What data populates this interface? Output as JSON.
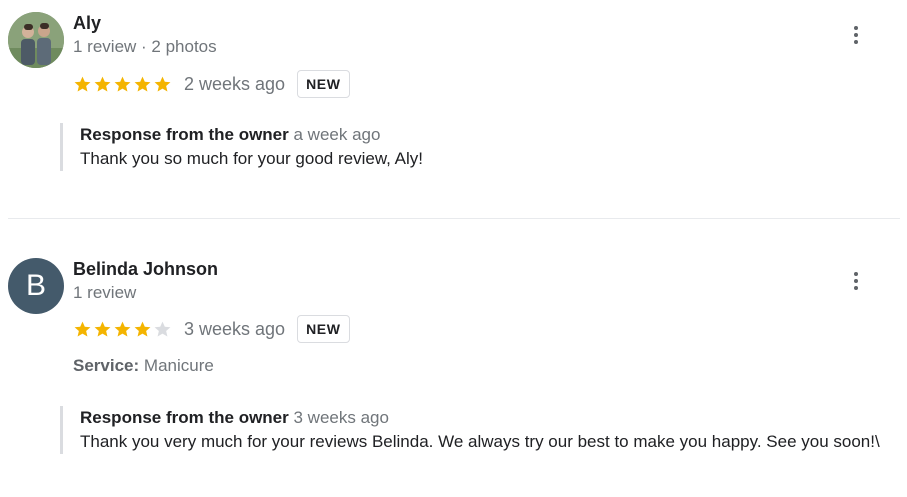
{
  "colors": {
    "star_filled": "#f4b400",
    "star_empty": "#dadce0",
    "avatar_bg": "#445a6b"
  },
  "reviews": [
    {
      "avatar_icon": "user-photo-avatar",
      "name": "Aly",
      "meta": "1 review · 2 photos",
      "rating": 5,
      "date": "2 weeks ago",
      "badge": "NEW",
      "response": {
        "title": "Response from the owner",
        "date": "a week ago",
        "text": "Thank you so much for your good review, Aly!"
      }
    },
    {
      "avatar_letter": "B",
      "name": "Belinda Johnson",
      "meta": "1 review",
      "rating": 4,
      "date": "3 weeks ago",
      "badge": "NEW",
      "service_label": "Service:",
      "service_value": "Manicure",
      "response": {
        "title": "Response from the owner",
        "date": "3 weeks ago",
        "text": "Thank you very much for your reviews Belinda. We always try our best to make you happy. See you soon!\\"
      }
    }
  ]
}
